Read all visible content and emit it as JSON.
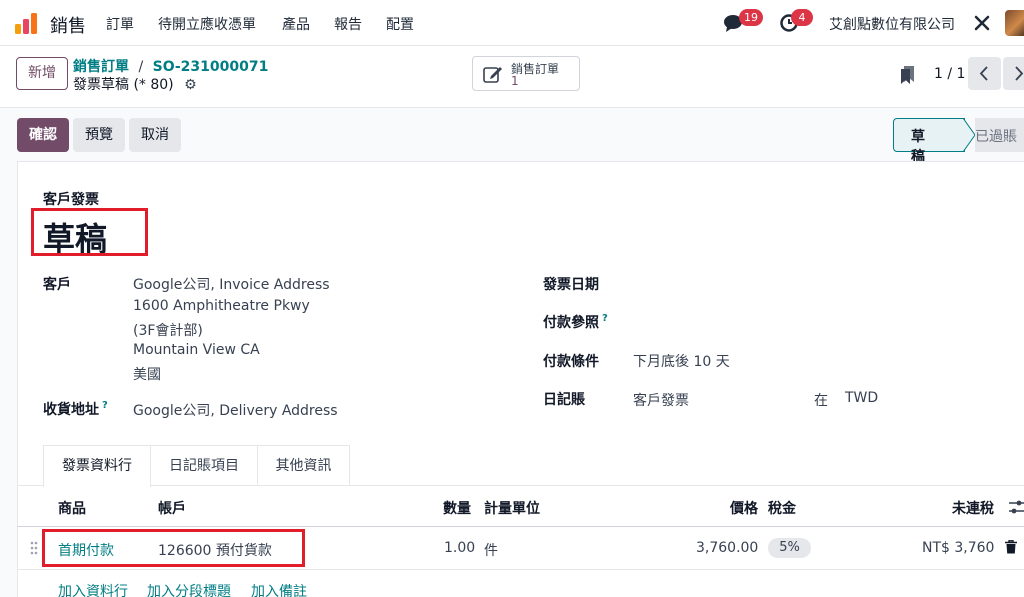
{
  "topnav": {
    "app_name": "銷售",
    "menu": [
      "訂單",
      "待開立應收憑單",
      "產品",
      "報告",
      "配置"
    ],
    "messages_count": "19",
    "activities_count": "4",
    "company": "艾創點數位有限公司"
  },
  "breadcrumb": {
    "parent": "銷售訂單",
    "separator": "/",
    "order": "SO-231000071",
    "current": "發票草稿 (* 80)"
  },
  "control": {
    "new_label": "新增",
    "smart_button_title": "銷售訂單",
    "smart_button_count": "1",
    "pager": "1 / 1"
  },
  "actions": {
    "confirm": "確認",
    "preview": "預覽",
    "cancel": "取消"
  },
  "statusbar": {
    "current": "草稿",
    "next": "已過賬"
  },
  "invoice": {
    "type": "客戶發票",
    "title": "草稿",
    "customer_label": "客戶",
    "customer_lines": [
      "Google公司, Invoice Address",
      "1600 Amphitheatre Pkwy",
      "(3F會計部)",
      "Mountain View CA",
      "美國"
    ],
    "delivery_label": "收貨地址",
    "delivery_help": "?",
    "delivery_value": "Google公司, Delivery Address",
    "invoice_date_label": "發票日期",
    "payment_ref_label": "付款參照",
    "payment_ref_help": "?",
    "payment_terms_label": "付款條件",
    "payment_terms_value": "下月底後 10 天",
    "journal_label": "日記賬",
    "journal_value": "客戶發票",
    "currency_in": "在",
    "currency": "TWD"
  },
  "tabs": [
    "發票資料行",
    "日記賬項目",
    "其他資訊"
  ],
  "lines": {
    "headers": {
      "product": "商品",
      "account": "帳戶",
      "quantity": "數量",
      "uom": "計量單位",
      "price": "價格",
      "tax": "稅金",
      "subtotal": "未連稅"
    },
    "rows": [
      {
        "product": "首期付款",
        "account": "126600 預付貨款",
        "quantity": "1.00",
        "uom": "件",
        "price": "3,760.00",
        "tax": "5%",
        "subtotal": "NT$ 3,760"
      }
    ],
    "add_line": "加入資料行",
    "add_section": "加入分段標題",
    "add_note": "加入備註"
  },
  "colors": {
    "brand": "#714b67",
    "link": "#017e84",
    "badge": "#dc3545",
    "highlight": "#e11d2b"
  }
}
